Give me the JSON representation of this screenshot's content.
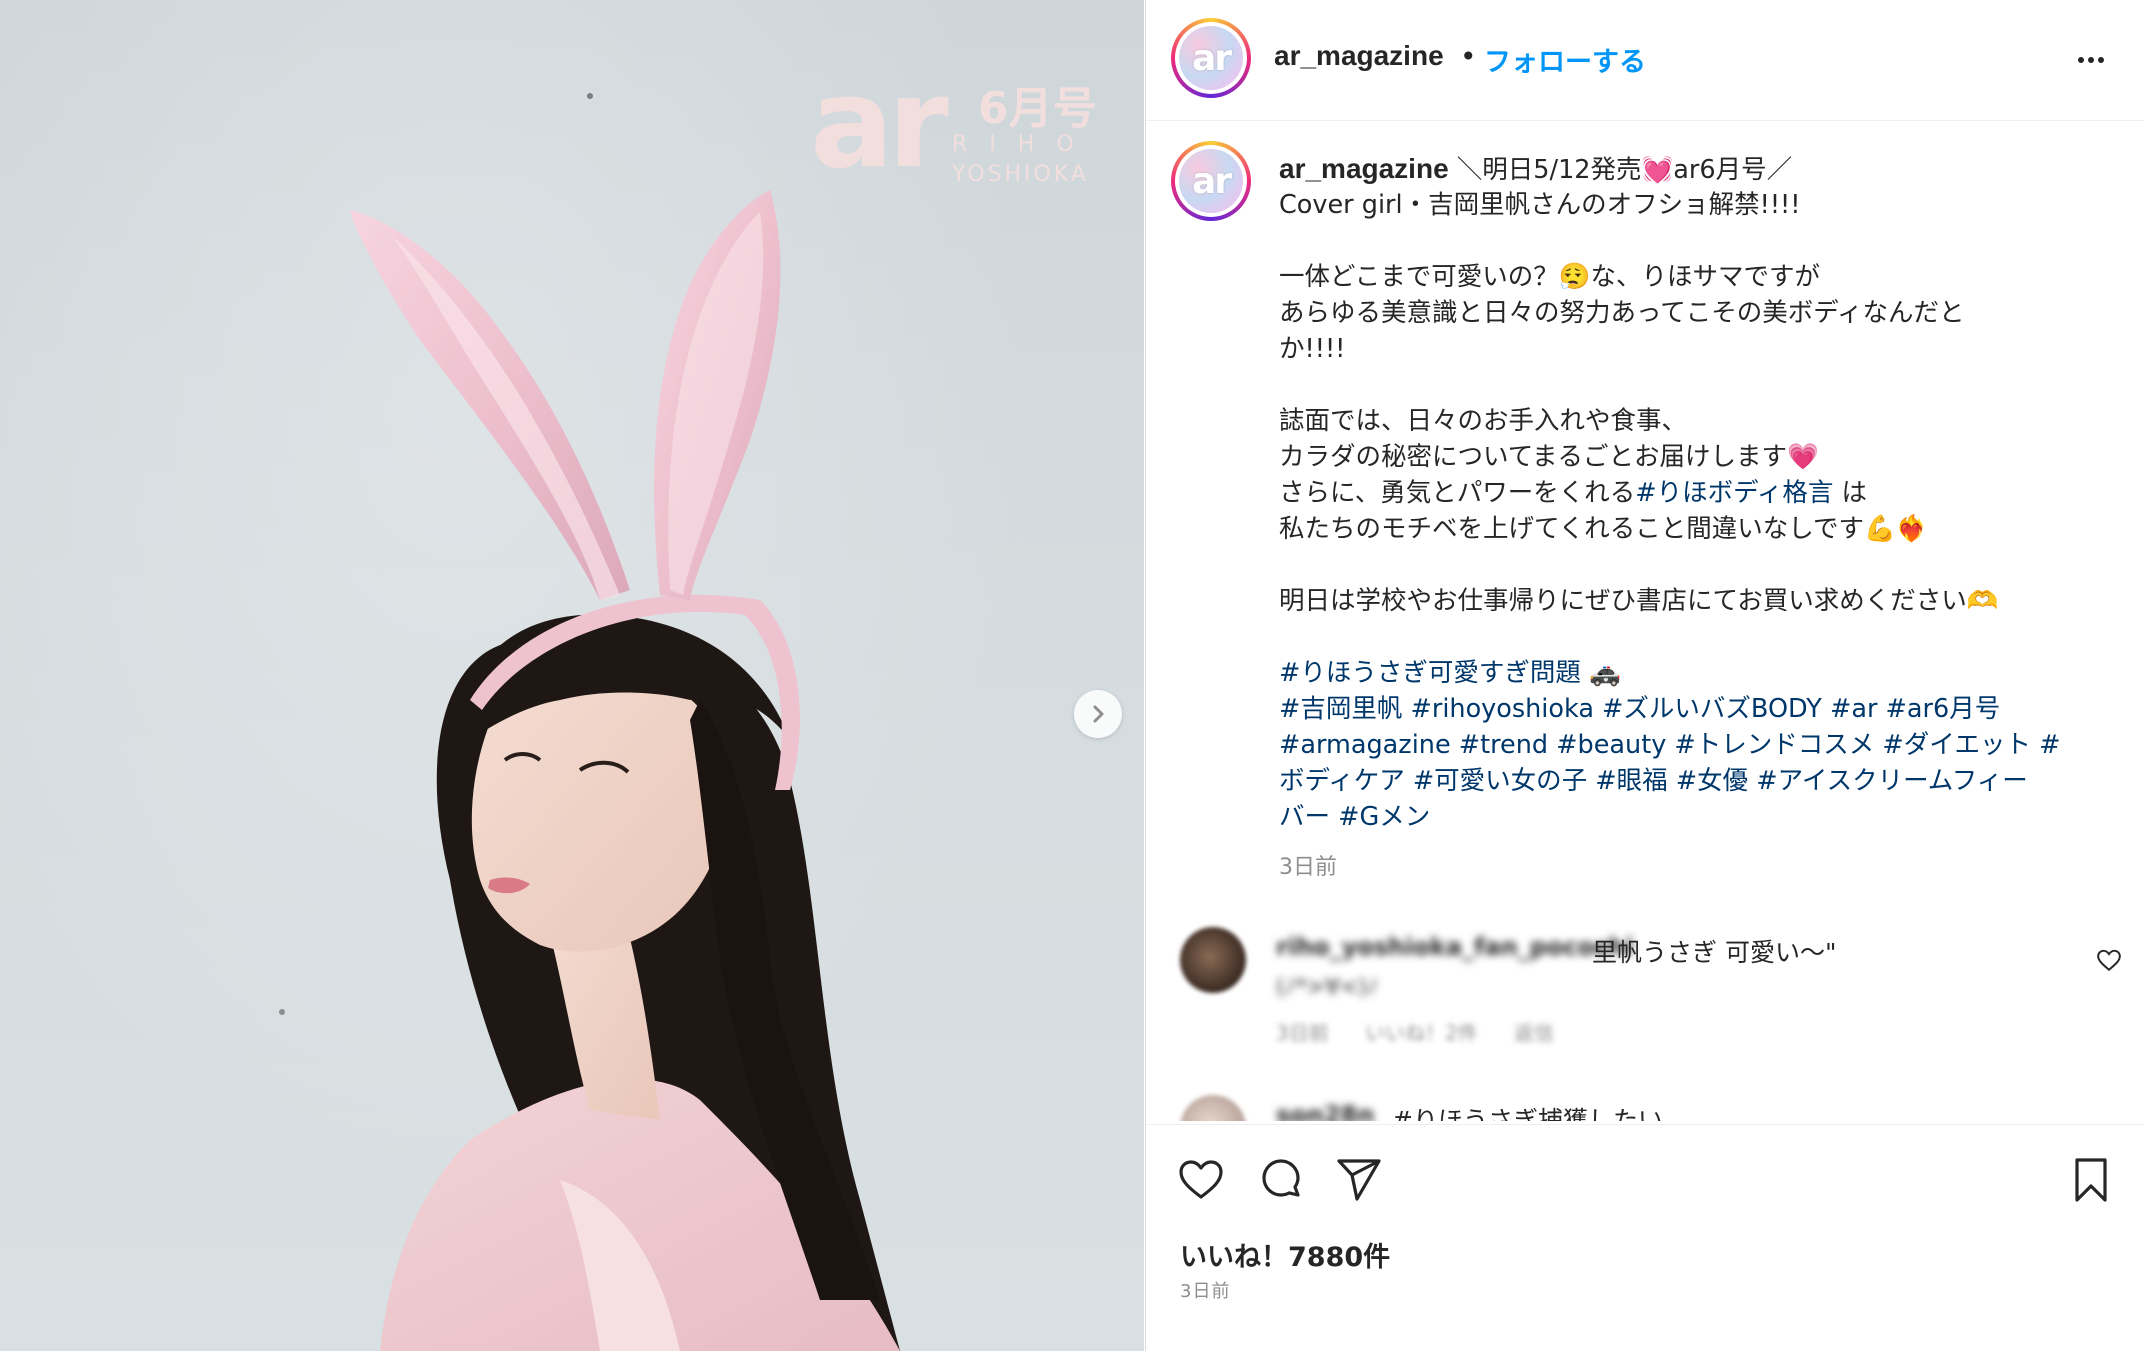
{
  "media": {
    "logo_text": "ar",
    "logo_issue": "6月号",
    "logo_name_line1": "RIHO",
    "logo_name_line2": "YOSHIOKA",
    "carousel_next_icon": "chevron-right-icon"
  },
  "header": {
    "avatar_text": "ar",
    "username": "ar_magazine",
    "separator": "•",
    "follow_label": "フォローする",
    "more_icon": "more-horizontal-icon"
  },
  "caption": {
    "username": "ar_magazine",
    "lines": [
      "＼明日5/12発売💓ar6月号／",
      "Cover girl・吉岡里帆さんのオフショ解禁!!!!",
      "",
      "一体どこまで可愛いの？😮‍💨な、りほサマですが",
      "あらゆる美意識と日々の努力あってこその美ボディなんだと",
      "か!!!!",
      "",
      "誌面では、日々のお手入れや食事、",
      "カラダの秘密についてまるごとお届けします💗",
      "さらに、勇気とパワーをくれる",
      "私たちのモチベを上げてくれること間違いなしです💪❤️‍🔥",
      "",
      "明日は学校やお仕事帰りにぜひ書店にてお買い求めください🫶"
    ],
    "inline_tag": "#りほボディ格言",
    "inline_tag_suffix": " は",
    "hashtag_lines": [
      "#りほうさぎ可愛すぎ問題 🚓",
      "#吉岡里帆 #rihoyoshioka #ズルいバズBODY #ar #ar6月号",
      "#armagazine #trend #beauty #トレンドコスメ #ダイエット #",
      "ボディケア #可愛い女の子 #眼福 #女優 #アイスクリームフィー",
      "バー #Gメン"
    ],
    "time": "3日前"
  },
  "comments": [
    {
      "username": "riho_yoshioka_fan_pocochi",
      "text": "里帆うさぎ 可愛い〜\"",
      "text2": "(ﾉ*>∀<)ﾉ",
      "meta": "3日前 いいね！2件 返信"
    },
    {
      "username": "son28n",
      "text": "#りほうさぎ捕獲したい"
    }
  ],
  "actions": {
    "like_icon": "heart-icon",
    "comment_icon": "comment-icon",
    "share_icon": "send-icon",
    "save_icon": "bookmark-icon",
    "likes": "いいね！7880件",
    "date": "3日前"
  }
}
